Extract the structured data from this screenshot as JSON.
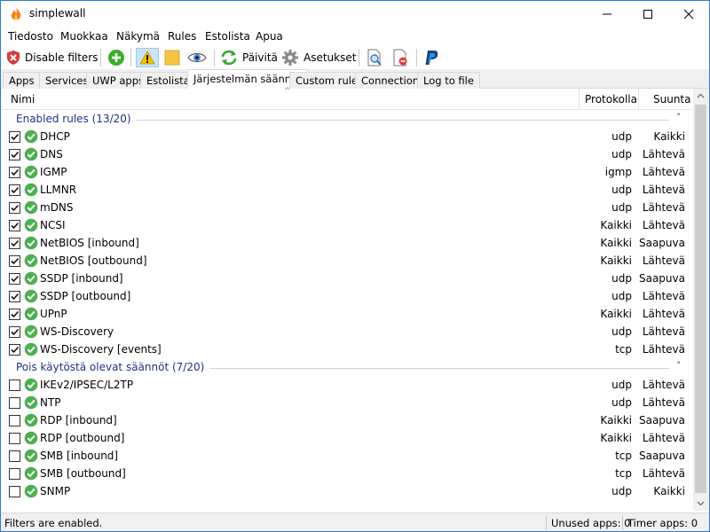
{
  "window": {
    "title": "simplewall"
  },
  "menu": [
    "Tiedosto",
    "Muokkaa",
    "Näkymä",
    "Rules",
    "Estolista",
    "Apua"
  ],
  "toolbar": {
    "disable_filters": "Disable filters",
    "refresh": "Päivitä",
    "settings": "Asetukset"
  },
  "tabs": [
    "Apps",
    "Services",
    "UWP apps",
    "Estolista",
    "Järjestelmän säännöt",
    "Custom rules",
    "Connections",
    "Log to file"
  ],
  "active_tab": "Järjestelmän säännöt",
  "columns": {
    "name": "Nimi",
    "protocol": "Protokolla",
    "direction": "Suunta"
  },
  "groups": [
    {
      "title": "Enabled rules (13/20)",
      "checked": true,
      "rows": [
        {
          "name": "DHCP",
          "protocol": "udp",
          "direction": "Kaikki"
        },
        {
          "name": "DNS",
          "protocol": "udp",
          "direction": "Lähtevä"
        },
        {
          "name": "IGMP",
          "protocol": "igmp",
          "direction": "Lähtevä"
        },
        {
          "name": "LLMNR",
          "protocol": "udp",
          "direction": "Lähtevä"
        },
        {
          "name": "mDNS",
          "protocol": "udp",
          "direction": "Lähtevä"
        },
        {
          "name": "NCSI",
          "protocol": "Kaikki",
          "direction": "Lähtevä"
        },
        {
          "name": "NetBIOS [inbound]",
          "protocol": "Kaikki",
          "direction": "Saapuva"
        },
        {
          "name": "NetBIOS [outbound]",
          "protocol": "Kaikki",
          "direction": "Lähtevä"
        },
        {
          "name": "SSDP [inbound]",
          "protocol": "udp",
          "direction": "Saapuva"
        },
        {
          "name": "SSDP [outbound]",
          "protocol": "udp",
          "direction": "Lähtevä"
        },
        {
          "name": "UPnP",
          "protocol": "Kaikki",
          "direction": "Lähtevä"
        },
        {
          "name": "WS-Discovery",
          "protocol": "udp",
          "direction": "Lähtevä"
        },
        {
          "name": "WS-Discovery [events]",
          "protocol": "tcp",
          "direction": "Lähtevä"
        }
      ]
    },
    {
      "title": "Pois käytöstä olevat säännöt (7/20)",
      "checked": false,
      "rows": [
        {
          "name": "IKEv2/IPSEC/L2TP",
          "protocol": "udp",
          "direction": "Lähtevä"
        },
        {
          "name": "NTP",
          "protocol": "udp",
          "direction": "Lähtevä"
        },
        {
          "name": "RDP [inbound]",
          "protocol": "Kaikki",
          "direction": "Saapuva"
        },
        {
          "name": "RDP [outbound]",
          "protocol": "Kaikki",
          "direction": "Lähtevä"
        },
        {
          "name": "SMB [inbound]",
          "protocol": "tcp",
          "direction": "Saapuva"
        },
        {
          "name": "SMB [outbound]",
          "protocol": "tcp",
          "direction": "Lähtevä"
        },
        {
          "name": "SNMP",
          "protocol": "udp",
          "direction": "Kaikki"
        }
      ]
    }
  ],
  "status": {
    "main": "Filters are enabled.",
    "unused": "Unused apps: 0",
    "timer": "Timer apps: 0"
  },
  "colors": {
    "accent": "#2b7bd6",
    "group_text": "#1e3287",
    "ok_green": "#4caf50"
  }
}
